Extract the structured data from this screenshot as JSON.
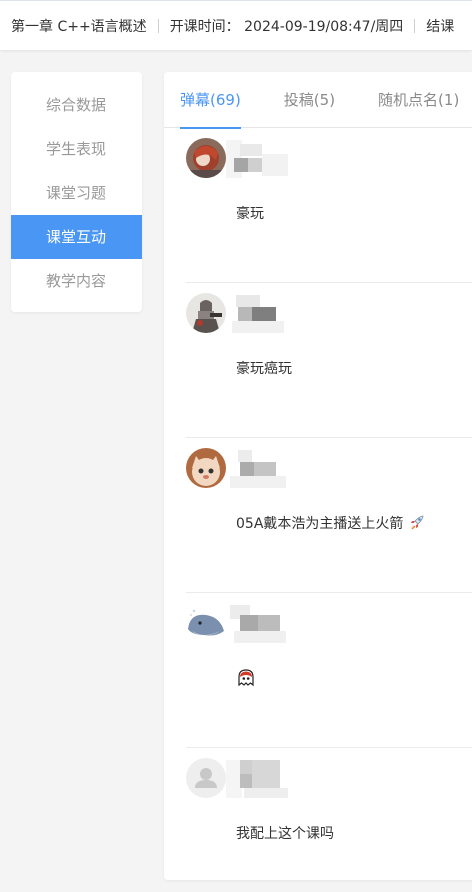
{
  "header": {
    "chapter": "第一章 C++语言概述",
    "start_time_label": "开课时间：",
    "start_time_value": "2024-09-19/08:47/周四",
    "end_label": "结课"
  },
  "sidebar": {
    "items": [
      {
        "label": "综合数据",
        "active": false
      },
      {
        "label": "学生表现",
        "active": false
      },
      {
        "label": "课堂习题",
        "active": false
      },
      {
        "label": "课堂互动",
        "active": true
      },
      {
        "label": "教学内容",
        "active": false
      }
    ]
  },
  "tabs": [
    {
      "label": "弹幕(69)",
      "active": true
    },
    {
      "label": "投稿(5)",
      "active": false
    },
    {
      "label": "随机点名(1)",
      "active": false
    }
  ],
  "messages": [
    {
      "text": "豪玩",
      "avatar": "avatar-red-hair",
      "emoji": ""
    },
    {
      "text": "豪玩癌玩",
      "avatar": "avatar-soldier",
      "emoji": ""
    },
    {
      "text": "05A戴本浩为主播送上火箭",
      "avatar": "avatar-cat",
      "emoji": "rocket-icon"
    },
    {
      "text": "",
      "avatar": "avatar-whale",
      "emoji": "ghost-icon"
    },
    {
      "text": "我配上这个课吗",
      "avatar": "avatar-default-person",
      "emoji": ""
    }
  ],
  "colors": {
    "accent": "#4a96f4",
    "background": "#f4f4f4",
    "muted_text": "#999999"
  }
}
